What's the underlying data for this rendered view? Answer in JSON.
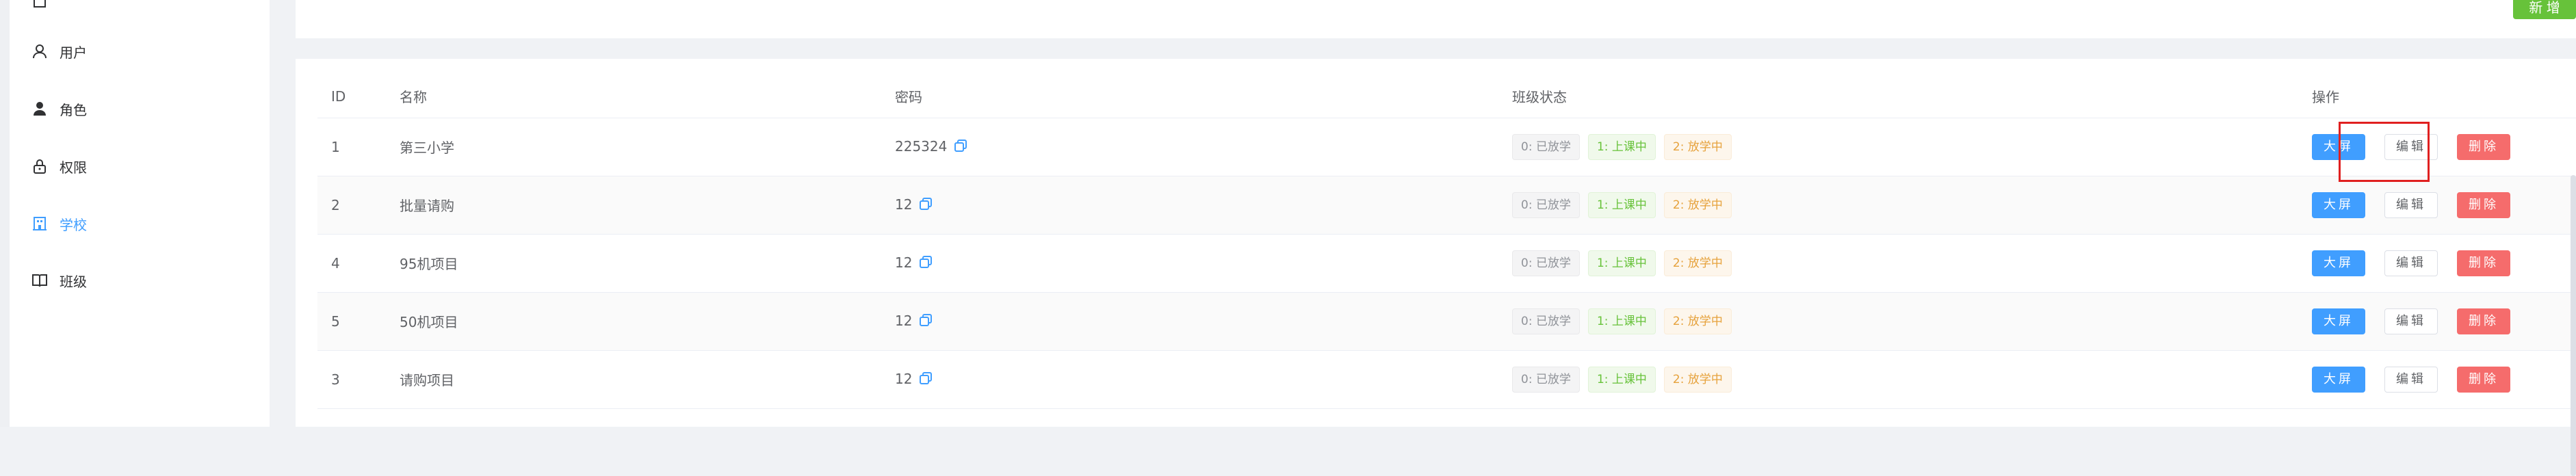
{
  "sidebar": {
    "items": [
      {
        "label": "用户",
        "icon": "user-icon"
      },
      {
        "label": "角色",
        "icon": "role-icon"
      },
      {
        "label": "权限",
        "icon": "lock-icon"
      },
      {
        "label": "学校",
        "icon": "school-icon",
        "active": true
      },
      {
        "label": "班级",
        "icon": "book-icon"
      }
    ]
  },
  "toolbar": {
    "add_label": "新 增"
  },
  "table": {
    "headers": {
      "id": "ID",
      "name": "名称",
      "password": "密码",
      "status": "班级状态",
      "actions": "操作"
    },
    "status_tags": {
      "s0": "0: 已放学",
      "s1": "1: 上课中",
      "s2": "2: 放学中"
    },
    "action_labels": {
      "screen": "大屏",
      "edit": "编辑",
      "delete": "删除"
    },
    "rows": [
      {
        "id": "1",
        "name": "第三小学",
        "password": "225324"
      },
      {
        "id": "2",
        "name": "批量请购",
        "password": "12"
      },
      {
        "id": "4",
        "name": "95机项目",
        "password": "12"
      },
      {
        "id": "5",
        "name": "50机项目",
        "password": "12"
      },
      {
        "id": "3",
        "name": "请购项目",
        "password": "12"
      }
    ]
  },
  "colors": {
    "primary": "#409eff",
    "success": "#67c23a",
    "danger": "#f56c6c",
    "warning": "#e6a23c",
    "highlight": "#e02020"
  }
}
